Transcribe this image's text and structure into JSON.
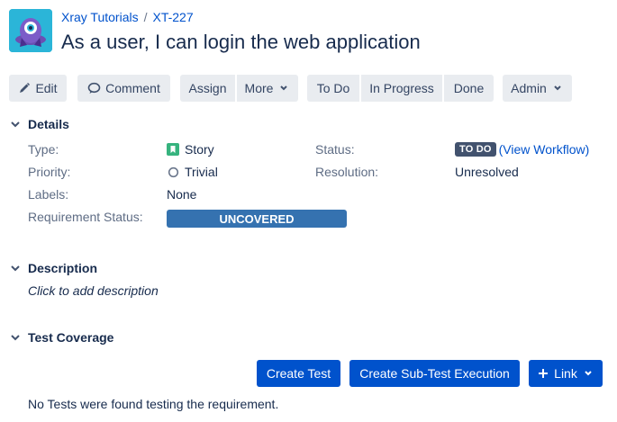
{
  "breadcrumbs": {
    "project": "Xray Tutorials",
    "separator": "/",
    "issue_key": "XT-227"
  },
  "issue": {
    "title": "As a user, I can login the web application"
  },
  "toolbar": {
    "edit": "Edit",
    "comment": "Comment",
    "assign": "Assign",
    "more": "More",
    "todo": "To Do",
    "in_progress": "In Progress",
    "done": "Done",
    "admin": "Admin"
  },
  "details": {
    "heading": "Details",
    "type_label": "Type:",
    "type_value": "Story",
    "priority_label": "Priority:",
    "priority_value": "Trivial",
    "labels_label": "Labels:",
    "labels_value": "None",
    "req_status_label": "Requirement Status:",
    "req_status_value": "UNCOVERED",
    "status_label": "Status:",
    "status_badge": "TO DO",
    "status_link": "(View Workflow)",
    "resolution_label": "Resolution:",
    "resolution_value": "Unresolved"
  },
  "description": {
    "heading": "Description",
    "placeholder": "Click to add description"
  },
  "test_coverage": {
    "heading": "Test Coverage",
    "create_test": "Create Test",
    "create_sub_test_execution": "Create Sub-Test Execution",
    "link": "Link",
    "empty_message": "No Tests were found testing the requirement."
  },
  "colors": {
    "accent": "#0052cc",
    "story_icon": "#36b37e",
    "uncovered_bar": "#3572b0",
    "todo_badge": "#42526e",
    "avatar_bg": "#2bb5d8"
  }
}
